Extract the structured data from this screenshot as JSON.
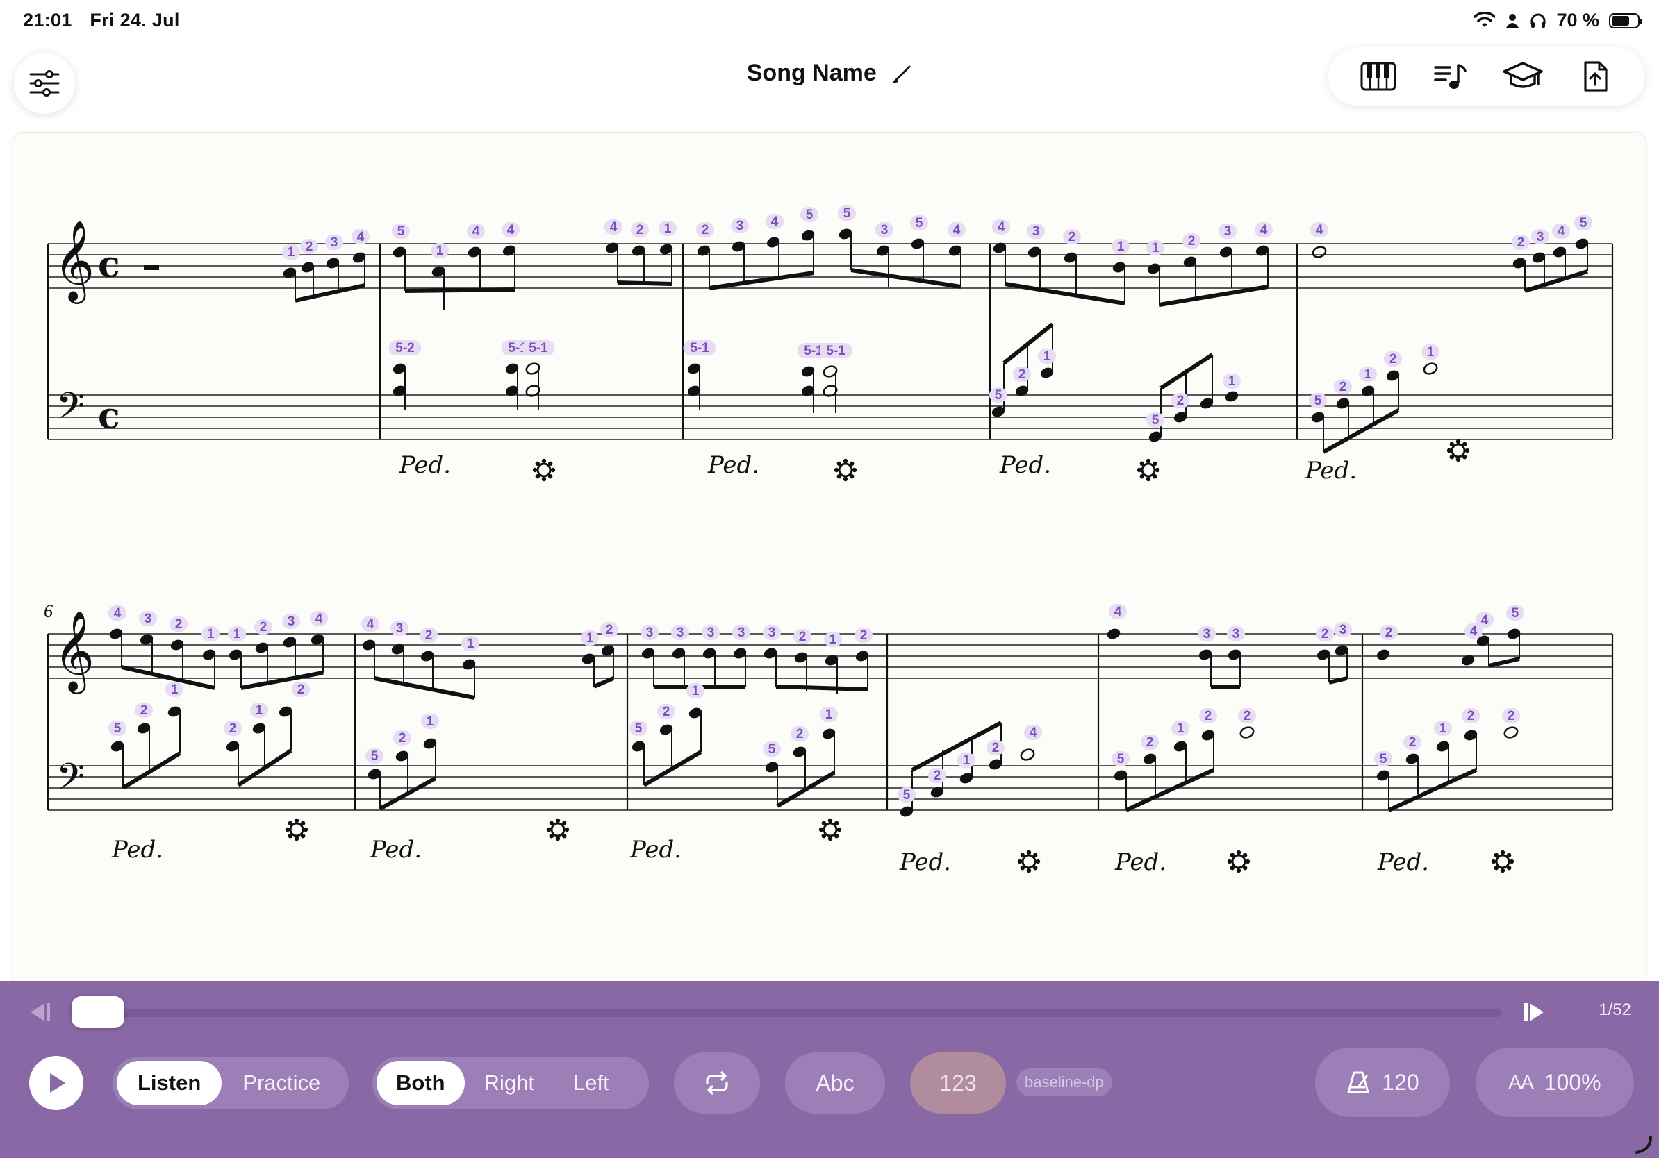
{
  "status_bar": {
    "time": "21:01",
    "date": "Fri 24. Jul",
    "battery_percent": "70 %",
    "battery_level": 0.7,
    "icons": [
      "wifi-icon",
      "person-icon",
      "headphones-icon",
      "battery-icon"
    ]
  },
  "header": {
    "title": "Song Name",
    "settings_icon": "sliders-icon",
    "tools": [
      "piano-keyboard-icon",
      "notes-list-icon",
      "graduation-cap-icon",
      "export-icon"
    ]
  },
  "score": {
    "measure_number_row2": "6",
    "fingering_color": "#7a4fb8",
    "fingering_bg": "#e6dcf3"
  },
  "playback": {
    "page_counter": "1/52",
    "progress": 0.0,
    "modes": [
      {
        "label": "Listen",
        "active": true
      },
      {
        "label": "Practice",
        "active": false
      }
    ],
    "hands": [
      {
        "label": "Both",
        "active": true
      },
      {
        "label": "Right",
        "active": false
      },
      {
        "label": "Left",
        "active": false
      }
    ],
    "notation_label": "Abc",
    "fingering_label": "123",
    "variant_tag": "baseline-dp",
    "tempo": "120",
    "zoom_prefix": "AA",
    "zoom": "100%"
  },
  "colors": {
    "accent_bar": "#8868a5",
    "segment_bg": "#9b7fb6",
    "fingering_pill": "#b08c9c"
  }
}
